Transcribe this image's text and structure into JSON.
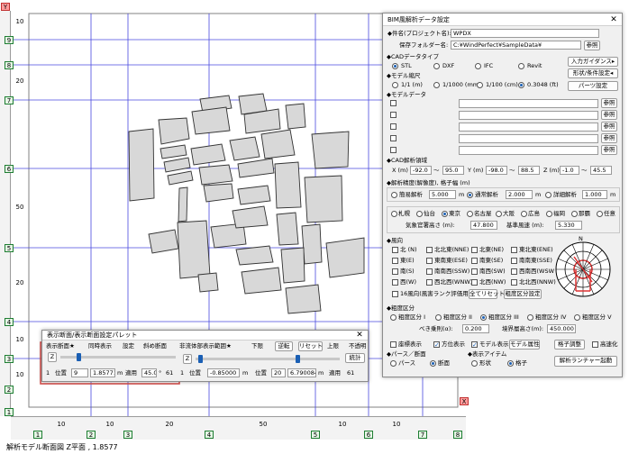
{
  "canvas": {
    "status_text": "解析モデル断面図 Z平面 , 1.8577",
    "left_axis_markers": [
      "Y",
      "9",
      "8",
      "7",
      "6",
      "5",
      "4",
      "3",
      "2",
      "1"
    ],
    "bottom_axis_markers": [
      "1",
      "2",
      "3",
      "4",
      "5",
      "6",
      "7",
      "8",
      "X"
    ],
    "bottom_dimensions": [
      "10",
      "10",
      "20",
      "50",
      "10",
      "10"
    ],
    "left_dimensions": [
      "10",
      "20",
      "50",
      "20",
      "10",
      "10"
    ]
  },
  "bim_dialog": {
    "title": "BIM風解析データ設定",
    "close_glyph": "✕",
    "project_name_label": "◆件名(プロジェクト名):",
    "project_name_value": "WPDX",
    "save_folder_label": "保存フォルダー名:",
    "save_folder_value": "C:¥WindPerfect¥SampleData¥",
    "browse_label": "参照",
    "cad_type_label": "◆CADデータタイプ",
    "cad_types": [
      "STL",
      "DXF",
      "IFC",
      "Revit"
    ],
    "cad_type_selected": "STL",
    "input_guidance_label": "入力ガイダンス▸",
    "shape_settings_label": "形状/条件設定◂",
    "model_scale_label": "◆モデル縮尺",
    "scales": [
      "1/1 (m)",
      "1/1000 (mm)",
      "1/100 (cm)",
      "0.3048 (ft)"
    ],
    "scale_selected": "0.3048 (ft)",
    "parts_settings_label": "パーツ設定",
    "model_data_label": "◆モデルデータ",
    "model_rows": 5,
    "cad_range_label": "◆CAD解析領域",
    "x_label": "X (m)",
    "x_min": "-92.0",
    "x_max": "95.0",
    "y_label": "Y (m)",
    "y_min": "-98.0",
    "y_max": "88.5",
    "z_label": "Z (m)",
    "z_min": "-1.0",
    "z_max": "45.5",
    "tilde": "〜",
    "precision_label": "◆解析精度(解像度), 格子幅 (m)",
    "precision_options": [
      {
        "label": "簡易解析",
        "value": "5.000",
        "unit": "m"
      },
      {
        "label": "通常解析",
        "value": "2.000",
        "unit": "m"
      },
      {
        "label": "詳細解析",
        "value": "1.000",
        "unit": "m"
      }
    ],
    "precision_selected": "通常解析",
    "cities": [
      "札幌",
      "仙台",
      "東京",
      "名古屋",
      "大阪",
      "広島",
      "福岡",
      "那覇",
      "任意"
    ],
    "city_selected": "東京",
    "station_height_label": "気象官署高さ (m):",
    "station_height_value": "47.800",
    "base_wind_label": "基準風速 (m):",
    "base_wind_value": "5.330",
    "wind_dir_label": "◆風向",
    "wind_dirs": [
      [
        "北 (N)",
        "北北東(NNE)",
        "北東(NE)",
        "東北東(ENE)"
      ],
      [
        "東(E)",
        "東南東(ESE)",
        "南東(SE)",
        "南南東(SSE)"
      ],
      [
        "南(S)",
        "南南西(SSW)",
        "南西(SW)",
        "西南西(WSW"
      ],
      [
        "西(W)",
        "西北西(WNW)",
        "北西(NW)",
        "北北西(NNW)"
      ]
    ],
    "sixteen_label": "16風向(風害ランク評価用)",
    "reset_all_label": "全てリセット",
    "roughness_setting_label": "粗度区分設定",
    "compass_n": "N",
    "roughness_label": "◆粗度区分",
    "roughness_options": [
      "粗度区分 I",
      "粗度区分 II",
      "粗度区分 III",
      "粗度区分 IV",
      "粗度区分 V"
    ],
    "roughness_selected": "粗度区分 III",
    "power_index_label": "べき乗則(α):",
    "power_index_value": "0.200",
    "boundary_height_label": "境界層高さ(m):",
    "boundary_height_value": "450.000",
    "show_coord_label": "座標表示",
    "show_dir_label": "方位表示",
    "model_display_label": "モデル表示",
    "model_attr_label": "モデル属性",
    "grid_adjust_label": "格子調整",
    "speedup_label": "高速化",
    "pers_label": "◆パース／断面",
    "pers_options": [
      "パース",
      "断面"
    ],
    "pers_selected": "断面",
    "display_items_label": "◆表示アイテム",
    "display_items": [
      "形状",
      "格子"
    ],
    "display_selected": "格子",
    "launcher_label": "解析ランチャー起動"
  },
  "palette": {
    "title": "表示断面/表示断面設定パレット",
    "close_glyph": "✕",
    "col1_header": "表示断面★",
    "sync_label": "同時表示",
    "settings_label": "設定",
    "oblique_label": "斜め断面",
    "axis_label": "Z",
    "index_value": "1",
    "pos_label": "位置",
    "pos_index": "9",
    "pos_value": "1.85771",
    "unit_m": "m",
    "apply_label": "適用",
    "apply_value": "45.0",
    "deg_symbol": "°",
    "num_61": "61",
    "col2_header": "非流体部表示範囲★",
    "lower_label": "下限",
    "reverse_label": "逆転",
    "reset_label": "リセット",
    "upper_label": "上限",
    "opaque_label": "不透明",
    "stats_label": "統計",
    "axis2_label": "Z",
    "index2_value": "1",
    "pos2_label": "位置",
    "lower_value": "-0.85000",
    "unit2_m": "m",
    "pos3_label": "位置",
    "upper_index": "20",
    "upper_value": "6.790084",
    "unit3_m": "m",
    "apply2_label": "適用",
    "num2_61": "61"
  },
  "colors": {
    "accent": "#1a5fb4",
    "highlight_box": "#d9534f",
    "grid_line": "#4a4adf",
    "building_fill": "#d8d8d8"
  }
}
